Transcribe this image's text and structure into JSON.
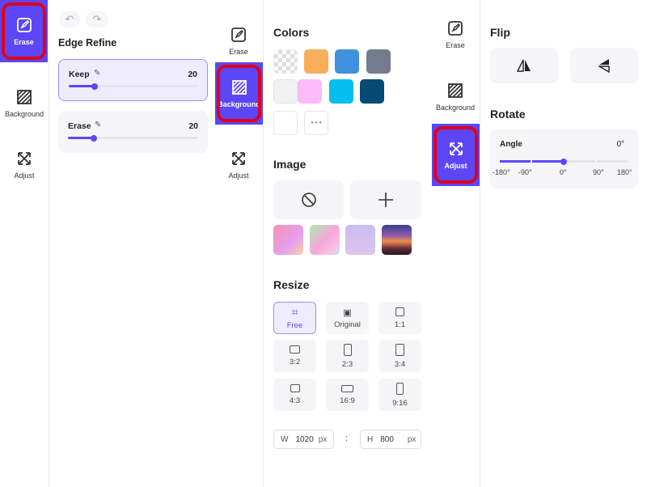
{
  "colors": {
    "accent": "#5b47f5",
    "highlight": "#e0001a",
    "swatches": [
      "transparent",
      "#f9ae5b",
      "#4190dd",
      "#737b8d",
      "#f2f2f2",
      "#fcbcf8",
      "#05bdf0",
      "#034a75",
      "#ffffff"
    ]
  },
  "nav": {
    "erase": "Erase",
    "background": "Background",
    "adjust": "Adjust"
  },
  "erase_panel": {
    "title": "Edge Refine",
    "keep": {
      "label": "Keep",
      "value": "20"
    },
    "erase": {
      "label": "Erase",
      "value": "20"
    },
    "keep_slider_fraction": 0.2,
    "erase_slider_fraction": 0.2
  },
  "background_panel": {
    "colors_title": "Colors",
    "more": "• • •",
    "image_title": "Image",
    "resize_title": "Resize",
    "resize_options": [
      "Free",
      "Original",
      "1:1",
      "3:2",
      "2:3",
      "3:4",
      "4:3",
      "16:9",
      "9:16"
    ],
    "width": {
      "prefix": "W",
      "value": "1020",
      "unit": "px"
    },
    "separator": ":",
    "height": {
      "prefix": "H",
      "value": "800",
      "unit": "px"
    }
  },
  "adjust_panel": {
    "flip_title": "Flip",
    "rotate_title": "Rotate",
    "angle_label": "Angle",
    "angle_value": "0°",
    "ticks": [
      "-180°",
      "-90°",
      "0°",
      "90°",
      "180°"
    ],
    "angle": 0
  }
}
